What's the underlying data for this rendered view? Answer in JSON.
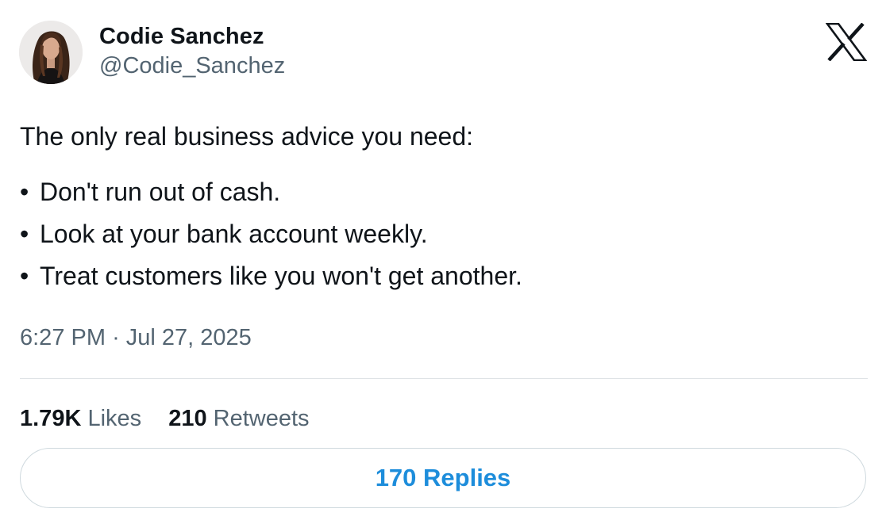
{
  "author": {
    "name": "Codie Sanchez",
    "handle": "@Codie_Sanchez"
  },
  "brand": {
    "logo_icon": "x-logo-icon"
  },
  "tweet": {
    "intro": "The only real business advice you need:",
    "bullets": [
      "Don't run out of cash.",
      "Look at your bank account weekly.",
      "Treat customers like you won't get another."
    ],
    "bullet_glyph": "•"
  },
  "meta": {
    "time": "6:27 PM",
    "separator": "·",
    "date": "Jul 27, 2025"
  },
  "stats": {
    "likes_count": "1.79K",
    "likes_label": "Likes",
    "retweets_count": "210",
    "retweets_label": "Retweets"
  },
  "replies_button": {
    "label": "170 Replies"
  },
  "colors": {
    "text_primary": "#0f1419",
    "text_secondary": "#536471",
    "accent": "#1d8ddb",
    "border": "#cfd9de"
  }
}
